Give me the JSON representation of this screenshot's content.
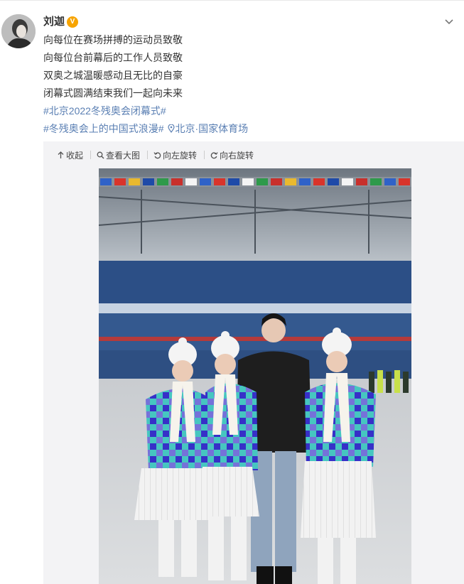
{
  "post": {
    "username": "刘迦",
    "verified_badge": "V",
    "lines": [
      "向每位在赛场拼搏的运动员致敬",
      "向每位台前幕后的工作人员致敬",
      "双奥之城温暖感动且无比的自豪",
      "闭幕式圆满结束我们一起向未来"
    ],
    "hashtag1": "#北京2022冬残奥会闭幕式#",
    "hashtag2": "#冬残奥会上的中国式浪漫#",
    "location": "北京·国家体育场"
  },
  "toolbar": {
    "collapse": "收起",
    "view_large": "查看大图",
    "rotate_left": "向左旋转",
    "rotate_right": "向右旋转"
  },
  "colors": {
    "link": "#5a7fb3",
    "badge": "#f7a400",
    "stadium_seats": "#2c4f86"
  },
  "icons": {
    "menu": "chevron-down-icon",
    "collapse": "collapse-arrow-icon",
    "view_large": "magnifier-icon",
    "rotate_left": "rotate-left-icon",
    "rotate_right": "rotate-right-icon",
    "location": "location-pin-icon"
  }
}
